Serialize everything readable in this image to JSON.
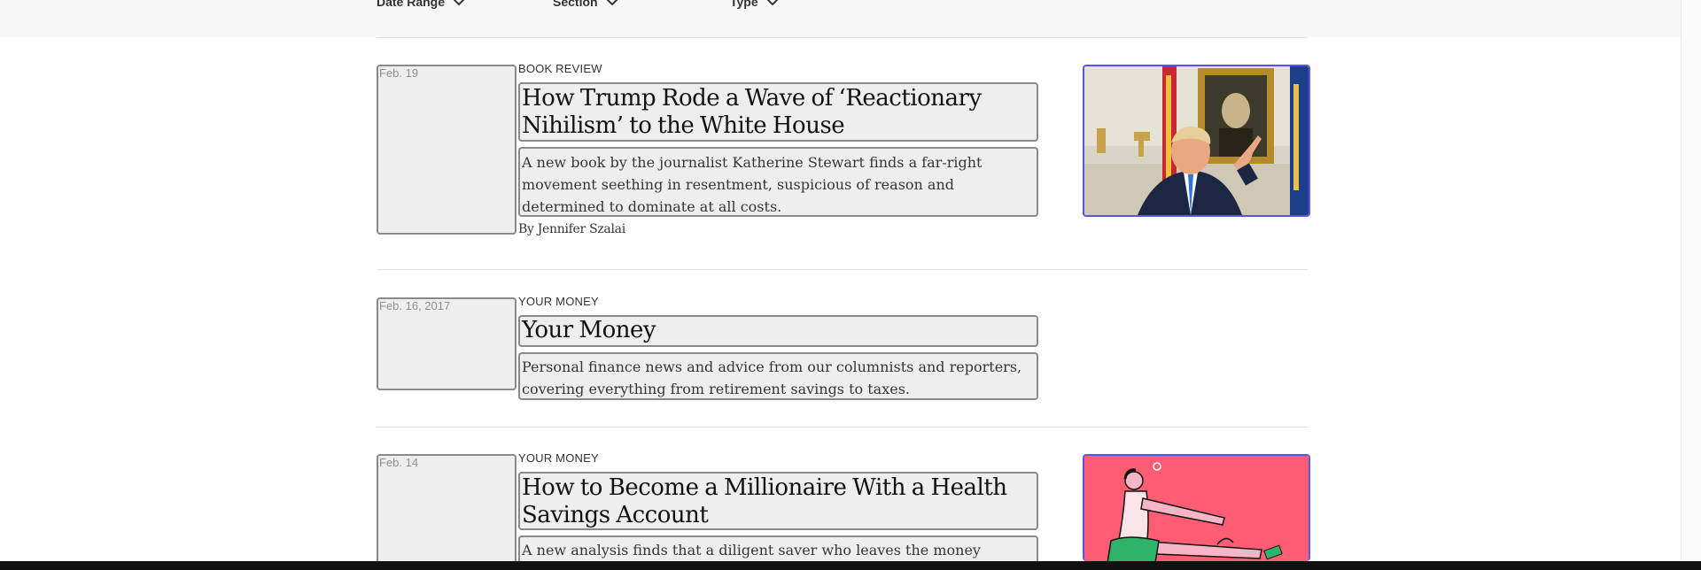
{
  "filters": [
    {
      "label": "Date Range"
    },
    {
      "label": "Section"
    },
    {
      "label": "Type"
    }
  ],
  "results": [
    {
      "date": "Feb. 19",
      "kicker": "BOOK REVIEW",
      "headline": "How Trump Rode a Wave of ‘Reactionary Nihilism’ to the White House",
      "summary": "A new book by the journalist Katherine Stewart finds a far-right movement seething in resentment, suspicious of reason and determined to dominate at all costs.",
      "byline": "By Jennifer Szalai",
      "image": "trump-oval-office-photo"
    },
    {
      "date": "Feb. 16, 2017",
      "kicker": "YOUR MONEY",
      "headline": "Your Money",
      "summary": "Personal finance news and advice from our columnists and reporters, covering everything from retirement savings to taxes."
    },
    {
      "date": "Feb. 14",
      "kicker": "YOUR MONEY",
      "headline": "How to Become a Millionaire With a Health Savings Account",
      "summary": "A new analysis finds that a diligent saver who leaves the money",
      "image": "millionaire-illustration"
    }
  ],
  "colors": {
    "thumbnail_border": "#5b55e6",
    "illustration_bg": "#ff5d73"
  }
}
